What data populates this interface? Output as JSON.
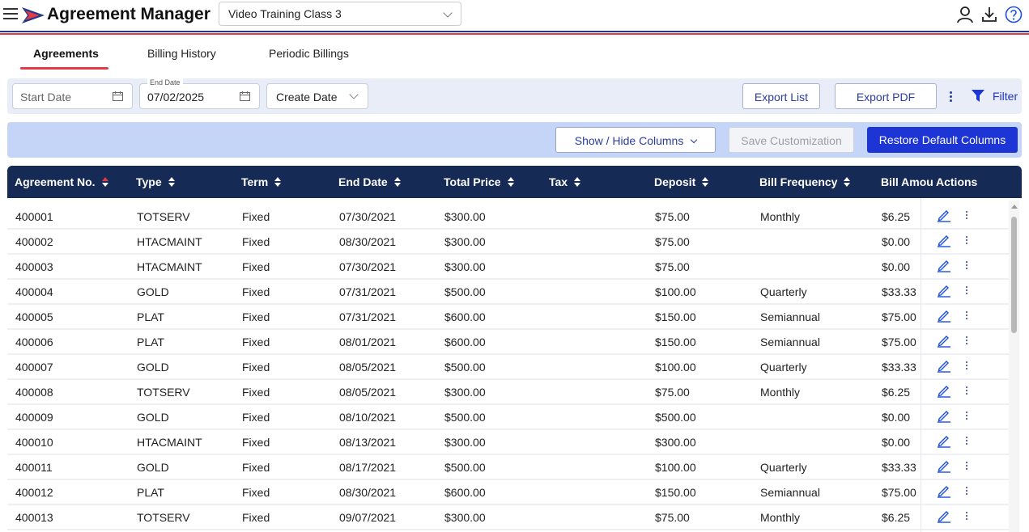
{
  "header": {
    "app_title": "Agreement Manager",
    "company_select": "Video Training Class 3",
    "icons": [
      "menu-icon",
      "user-icon",
      "download-icon",
      "help-icon"
    ],
    "brand_colors": {
      "navy": "#1f3a8a",
      "red": "#e23b45"
    }
  },
  "tabs": [
    {
      "label": "Agreements",
      "active": true
    },
    {
      "label": "Billing History",
      "active": false
    },
    {
      "label": "Periodic Billings",
      "active": false
    }
  ],
  "filters": {
    "start_date_placeholder": "Start Date",
    "end_date_label": "End Date",
    "end_date_value": "07/02/2025",
    "date_type": "Create Date",
    "export_list": "Export List",
    "export_pdf": "Export PDF",
    "filter": "Filter"
  },
  "customization": {
    "show_hide": "Show / Hide Columns",
    "save": "Save Customization",
    "restore": "Restore Default Columns"
  },
  "table": {
    "columns": [
      "Agreement No.",
      "Type",
      "Term",
      "End Date",
      "Total Price",
      "Tax",
      "Deposit",
      "Bill Frequency",
      "Bill Amou",
      "Actions"
    ],
    "rows": [
      [
        "400001",
        "TOTSERV",
        "Fixed",
        "07/30/2021",
        "$300.00",
        "",
        "$75.00",
        "Monthly",
        "$6.25"
      ],
      [
        "400002",
        "HTACMAINT",
        "Fixed",
        "08/30/2021",
        "$300.00",
        "",
        "$75.00",
        "",
        "$0.00"
      ],
      [
        "400003",
        "HTACMAINT",
        "Fixed",
        "07/30/2021",
        "$300.00",
        "",
        "$75.00",
        "",
        "$0.00"
      ],
      [
        "400004",
        "GOLD",
        "Fixed",
        "07/31/2021",
        "$500.00",
        "",
        "$100.00",
        "Quarterly",
        "$33.33"
      ],
      [
        "400005",
        "PLAT",
        "Fixed",
        "07/31/2021",
        "$600.00",
        "",
        "$150.00",
        "Semiannual",
        "$75.00"
      ],
      [
        "400006",
        "PLAT",
        "Fixed",
        "08/01/2021",
        "$600.00",
        "",
        "$150.00",
        "Semiannual",
        "$75.00"
      ],
      [
        "400007",
        "GOLD",
        "Fixed",
        "08/05/2021",
        "$500.00",
        "",
        "$100.00",
        "Quarterly",
        "$33.33"
      ],
      [
        "400008",
        "TOTSERV",
        "Fixed",
        "08/05/2021",
        "$300.00",
        "",
        "$75.00",
        "Monthly",
        "$6.25"
      ],
      [
        "400009",
        "GOLD",
        "Fixed",
        "08/10/2021",
        "$500.00",
        "",
        "$500.00",
        "",
        "$0.00"
      ],
      [
        "400010",
        "HTACMAINT",
        "Fixed",
        "08/13/2021",
        "$300.00",
        "",
        "$300.00",
        "",
        "$0.00"
      ],
      [
        "400011",
        "GOLD",
        "Fixed",
        "08/17/2021",
        "$500.00",
        "",
        "$100.00",
        "Quarterly",
        "$33.33"
      ],
      [
        "400012",
        "PLAT",
        "Fixed",
        "08/30/2021",
        "$600.00",
        "",
        "$150.00",
        "Semiannual",
        "$75.00"
      ],
      [
        "400013",
        "TOTSERV",
        "Fixed",
        "09/07/2021",
        "$300.00",
        "",
        "$75.00",
        "Monthly",
        "$6.25"
      ]
    ]
  }
}
